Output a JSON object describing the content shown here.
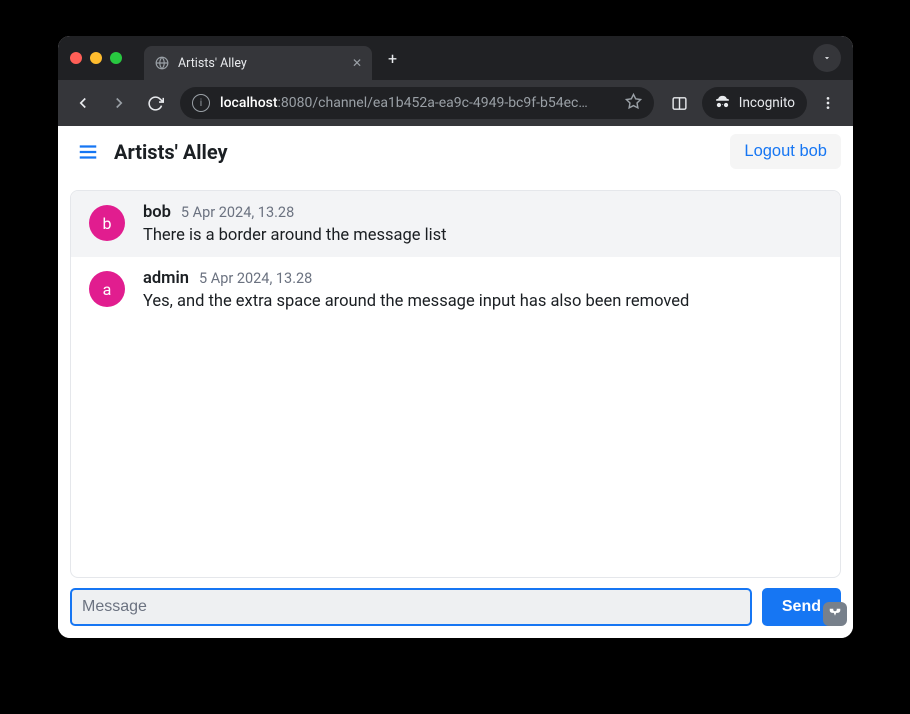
{
  "browser": {
    "tab_title": "Artists' Alley",
    "url_host": "localhost",
    "url_port_path": ":8080/channel/ea1b452a-ea9c-4949-bc9f-b54ec…",
    "incognito_label": "Incognito"
  },
  "header": {
    "title": "Artists' Alley",
    "logout_label": "Logout bob"
  },
  "messages": [
    {
      "avatar_letter": "b",
      "author": "bob",
      "timestamp": "5 Apr 2024, 13.28",
      "text": "There is a border around the message list",
      "highlight": true
    },
    {
      "avatar_letter": "a",
      "author": "admin",
      "timestamp": "5 Apr 2024, 13.28",
      "text": "Yes, and the extra space around the message input has also been removed",
      "highlight": false
    }
  ],
  "composer": {
    "placeholder": "Message",
    "value": "",
    "send_label": "Send"
  },
  "colors": {
    "accent": "#1676f3",
    "avatar": "#e11d8f"
  }
}
